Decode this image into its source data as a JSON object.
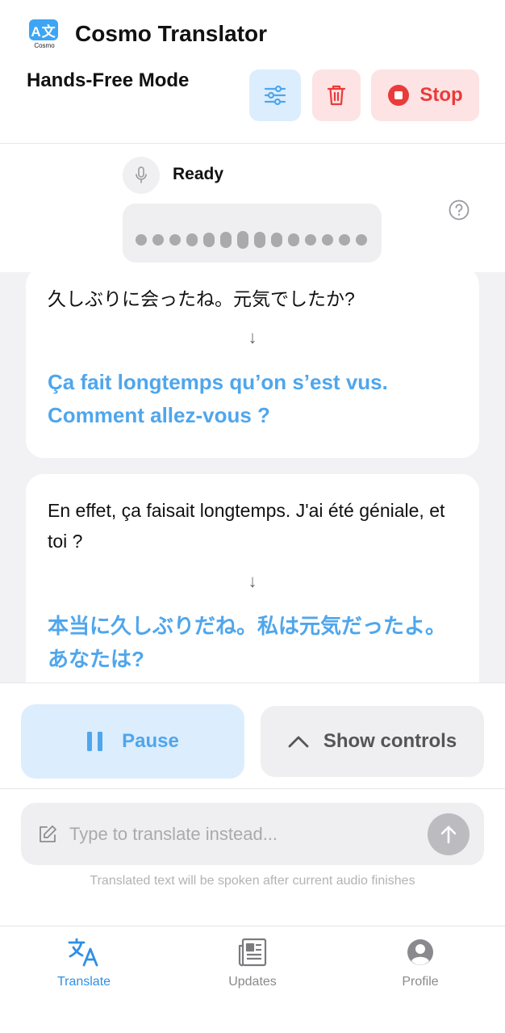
{
  "header": {
    "logo_text": "A文",
    "logo_sub": "Cosmo",
    "app_title": "Cosmo Translator",
    "mode_title": "Hands-Free Mode",
    "stop_label": "Stop"
  },
  "status": {
    "text": "Ready"
  },
  "conversation": [
    {
      "original": "久しぶりに会ったね。元気でしたか?",
      "translation": "Ça fait longtemps qu’on s’est vus. Comment allez-vous ?"
    },
    {
      "original": "En effet, ça faisait longtemps. J'ai été géniale, et toi ?",
      "translation": "本当に久しぶりだね。私は元気だったよ。あなたは?"
    }
  ],
  "controls": {
    "pause_label": "Pause",
    "show_controls_label": "Show controls"
  },
  "input": {
    "placeholder": "Type to translate instead...",
    "value": "",
    "hint": "Translated text will be spoken after current audio finishes"
  },
  "tabs": [
    {
      "label": "Translate",
      "icon": "translate-icon",
      "active": true
    },
    {
      "label": "Updates",
      "icon": "news-icon",
      "active": false
    },
    {
      "label": "Profile",
      "icon": "profile-icon",
      "active": false
    }
  ],
  "colors": {
    "accent": "#4fa6ec",
    "danger": "#ea3b3b",
    "danger_bg": "#fde3e3",
    "accent_bg": "#dcedfd"
  }
}
